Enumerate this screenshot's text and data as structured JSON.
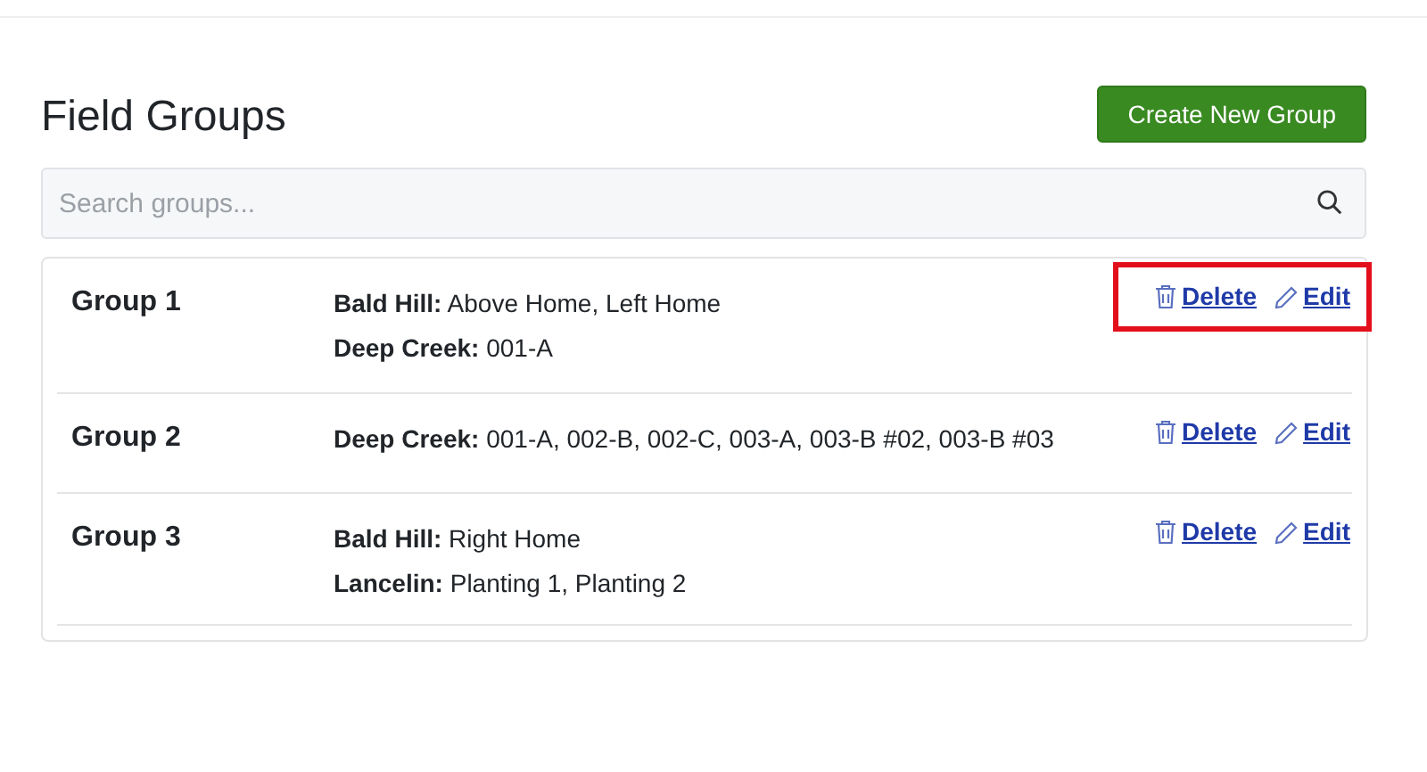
{
  "title": "Field Groups",
  "create_button": "Create New Group",
  "search": {
    "placeholder": "Search groups..."
  },
  "groups": [
    {
      "name": "Group 1",
      "lines": [
        "**Bald Hill:** Above Home, Left Home",
        "**Deep Creek:** 001-A"
      ],
      "delete": "Delete",
      "edit": "Edit",
      "highlighted": true
    },
    {
      "name": "Group 2",
      "lines": [
        "**Deep Creek:** 001-A, 002-B, 002-C, 003-A, 003-B #02, 003-B #03"
      ],
      "delete": "Delete",
      "edit": "Edit",
      "highlighted": false
    },
    {
      "name": "Group 3",
      "lines": [
        "**Bald Hill:** Right Home",
        "**Lancelin:** Planting 1, Planting 2"
      ],
      "delete": "Delete",
      "edit": "Edit",
      "highlighted": false
    }
  ]
}
